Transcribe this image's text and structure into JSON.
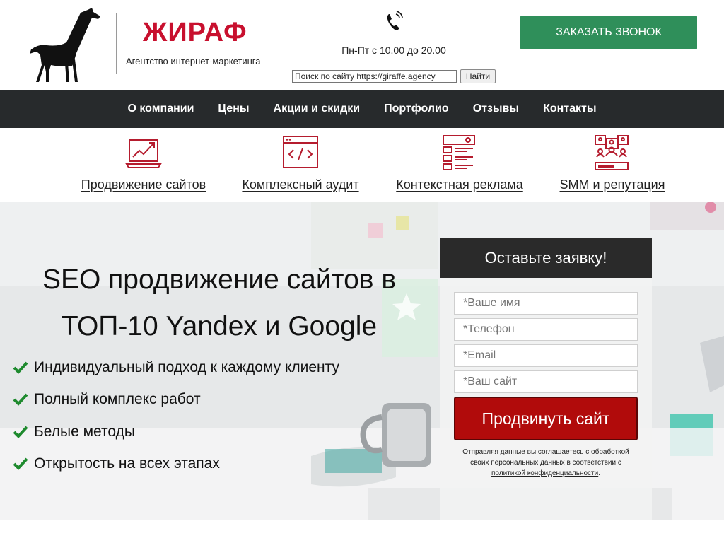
{
  "header": {
    "brand": "ЖИРАФ",
    "tagline": "Агентство интернет-маркетинга",
    "hours": "Пн-Пт с 10.00 до 20.00",
    "search": {
      "value": "Поиск по сайту https://giraffe.agency",
      "button": "Найти"
    },
    "call_button": "ЗАКАЗАТЬ ЗВОНОК"
  },
  "nav": {
    "items": [
      "О компании",
      "Цены",
      "Акции и скидки",
      "Портфолио",
      "Отзывы",
      "Контакты"
    ]
  },
  "services": [
    {
      "label": "Продвижение сайтов",
      "icon": "laptop-chart-icon"
    },
    {
      "label": "Комплексный аудит",
      "icon": "code-window-icon"
    },
    {
      "label": "Контекстная реклама",
      "icon": "search-ads-icon"
    },
    {
      "label": "SMM и репутация",
      "icon": "social-people-icon"
    }
  ],
  "hero": {
    "title_line1": "SEO продвижение сайтов в",
    "title_line2": "ТОП-10 Yandex и Google",
    "bullets": [
      "Индивидуальный подход к каждому клиенту",
      "Полный комплекс работ",
      "Белые методы",
      "Открытость на всех этапах"
    ]
  },
  "form": {
    "title": "Оставьте заявку!",
    "name_placeholder": "*Ваше имя",
    "phone_placeholder": "*Телефон",
    "email_placeholder": "*Email",
    "site_placeholder": "*Ваш сайт",
    "submit": "Продвинуть сайт",
    "consent_line1": "Отправляя данные вы соглашаетесь с обработкой",
    "consent_line2": "своих персональных данных в соответствии с",
    "consent_link": "политикой конфиденциальности",
    "consent_end": "."
  },
  "colors": {
    "brand_red": "#c8102e",
    "call_green": "#2f8f5a",
    "nav_dark": "#272a2c",
    "submit_red": "#b10b0b",
    "check_green": "#1e8a2e"
  }
}
